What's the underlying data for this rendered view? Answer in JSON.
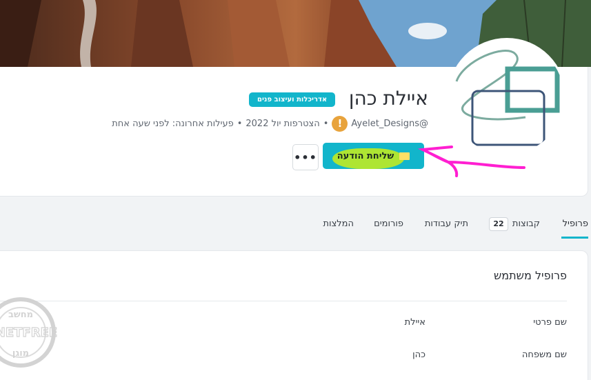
{
  "profile": {
    "name": "איילת כהן",
    "badge": "אדריכלות ועיצוב פנים",
    "username": "@Ayelet_Designs",
    "rank_symbol": "!",
    "joined": "הצטרפות יול 2022",
    "last_activity": "פעילות אחרונה: לפני שעה אחת",
    "separator": "•"
  },
  "actions": {
    "send_message_label": "שליחת הודעה",
    "more_label": "•••"
  },
  "tabs": [
    {
      "label": "פרופיל",
      "active": true
    },
    {
      "label": "קבוצות",
      "count": "22"
    },
    {
      "label": "תיק עבודות"
    },
    {
      "label": "פורומים"
    },
    {
      "label": "המלצות"
    }
  ],
  "user_profile": {
    "title": "פרופיל משתמש",
    "fields": [
      {
        "label": "שם פרטי",
        "value": "איילת"
      },
      {
        "label": "שם משפחה",
        "value": "כהן"
      }
    ]
  },
  "watermark": {
    "text_top": "מחשב",
    "text_mid": "NETFREE",
    "text_bottom": "מוגן"
  },
  "colors": {
    "accent": "#12b5cb",
    "highlight": "#b7e82a",
    "annotation": "#ff1fd1",
    "rank": "#e8a33c"
  },
  "icons": {
    "envelope": "envelope-icon",
    "more": "more-icon",
    "rank": "rank-icon"
  }
}
